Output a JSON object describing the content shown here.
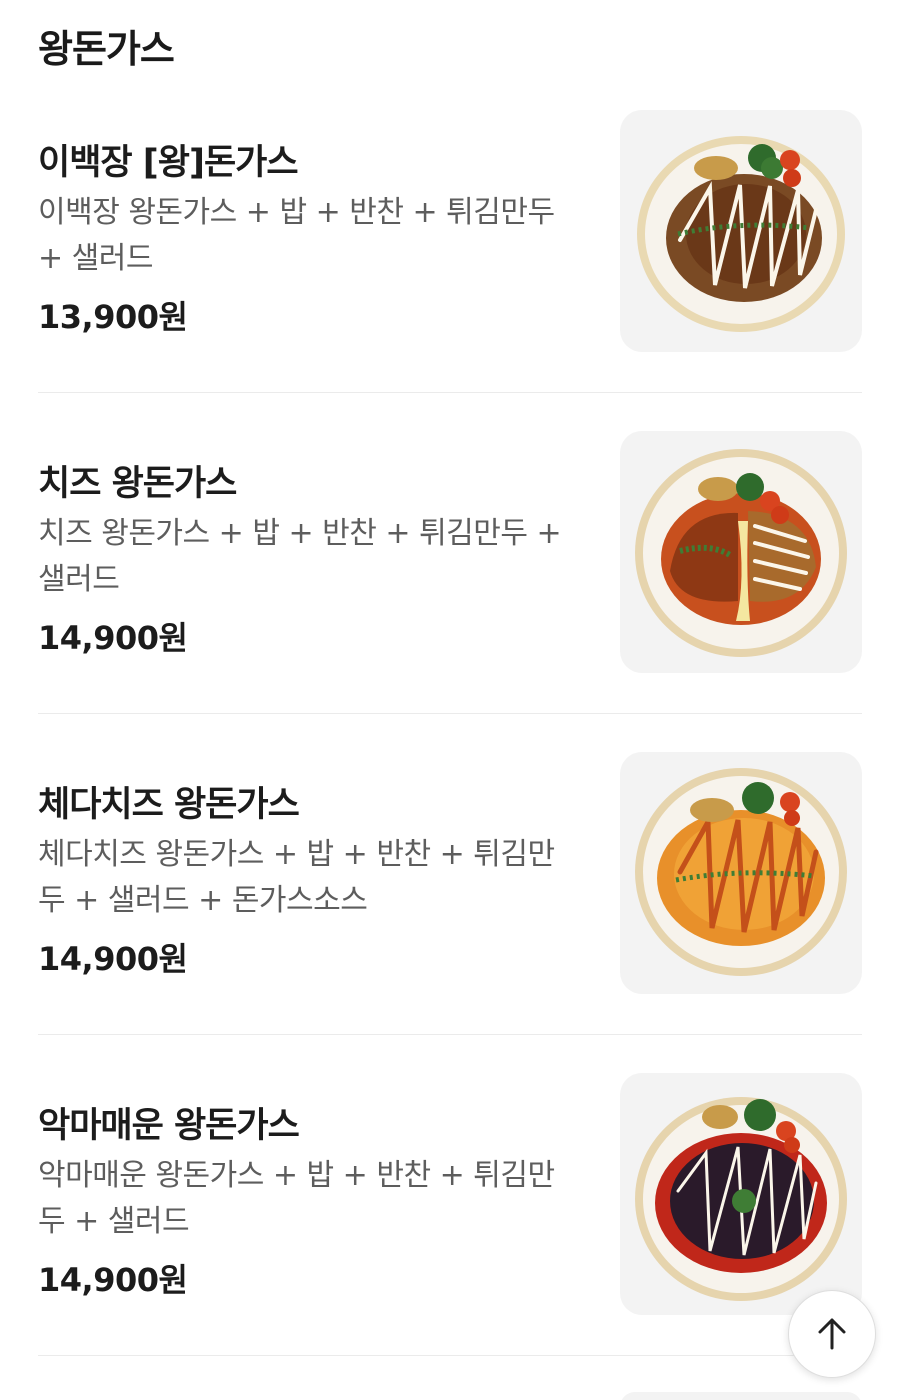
{
  "section": {
    "title": "왕돈가스"
  },
  "items": [
    {
      "name": "이백장 [왕]돈가스",
      "desc": "이백장 왕돈가스 + 밥 + 반찬 + 튀김만두 + 샐러드",
      "price": "13,900원"
    },
    {
      "name": "치즈 왕돈가스",
      "desc": "치즈 왕돈가스 + 밥 + 반찬 + 튀김만두 + 샐러드",
      "price": "14,900원"
    },
    {
      "name": "체다치즈 왕돈가스",
      "desc": "체다치즈 왕돈가스 + 밥 + 반찬 + 튀김만두 + 샐러드 + 돈가스소스",
      "price": "14,900원"
    },
    {
      "name": "악마매운 왕돈가스",
      "desc": "악마매운 왕돈가스 + 밥 + 반찬 + 튀김만두 + 샐러드",
      "price": "14,900원"
    }
  ],
  "scroll_top": {
    "icon": "arrow-up-icon"
  },
  "colors": {
    "text": "#1c1c1c",
    "desc": "#5d5d5d",
    "thumb_bg": "#f3f3f3",
    "divider": "#ebebeb"
  }
}
